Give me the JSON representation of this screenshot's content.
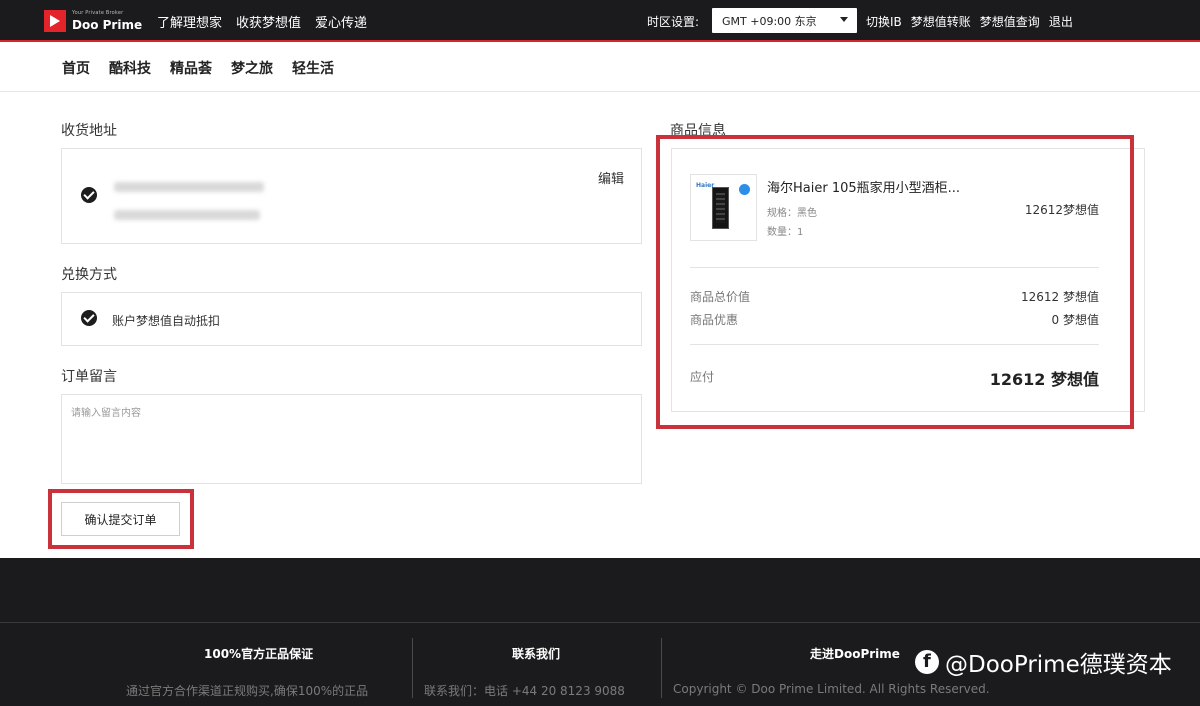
{
  "header": {
    "logo_tagline": "Your Private Broker",
    "logo_name": "Doo Prime",
    "nav": [
      "了解理想家",
      "收获梦想值",
      "爱心传递"
    ],
    "timezone_label": "时区设置:",
    "timezone_value": "GMT +09:00 东京",
    "links": [
      "切换IB",
      "梦想值转账",
      "梦想值查询",
      "退出"
    ]
  },
  "subnav": [
    "首页",
    "酷科技",
    "精品荟",
    "梦之旅",
    "轻生活"
  ],
  "address": {
    "title": "收货地址",
    "edit_label": "编辑"
  },
  "exchange": {
    "title": "兑换方式",
    "method": "账户梦想值自动抵扣"
  },
  "note": {
    "title": "订单留言",
    "placeholder": "请输入留言内容"
  },
  "submit_label": "确认提交订单",
  "product": {
    "title": "商品信息",
    "name": "海尔Haier 105瓶家用小型酒柜...",
    "brand": "Haier",
    "spec": "规格：黑色",
    "quantity": "数量：1",
    "price": "12612梦想值"
  },
  "summary": {
    "total_label": "商品总价值",
    "total_value": "12612 梦想值",
    "discount_label": "商品优惠",
    "discount_value": "0 梦想值",
    "pay_label": "应付",
    "pay_value": "12612 梦想值"
  },
  "footer": {
    "col1_title": "100%官方正品保证",
    "col1_text": "通过官方合作渠道正规购买,确保100%的正品",
    "col2_title": "联系我们",
    "col2_text": "联系我们：电话 +44 20 8123 9088",
    "col3_title": "走进DooPrime",
    "col3_text": "Copyright © Doo Prime Limited. All Rights Reserved."
  },
  "watermark": "@DooPrime德璞资本",
  "colors": {
    "topbar": "#1b1b1d",
    "accent_red": "#d6252f",
    "highlight_frame": "#c9323b"
  }
}
